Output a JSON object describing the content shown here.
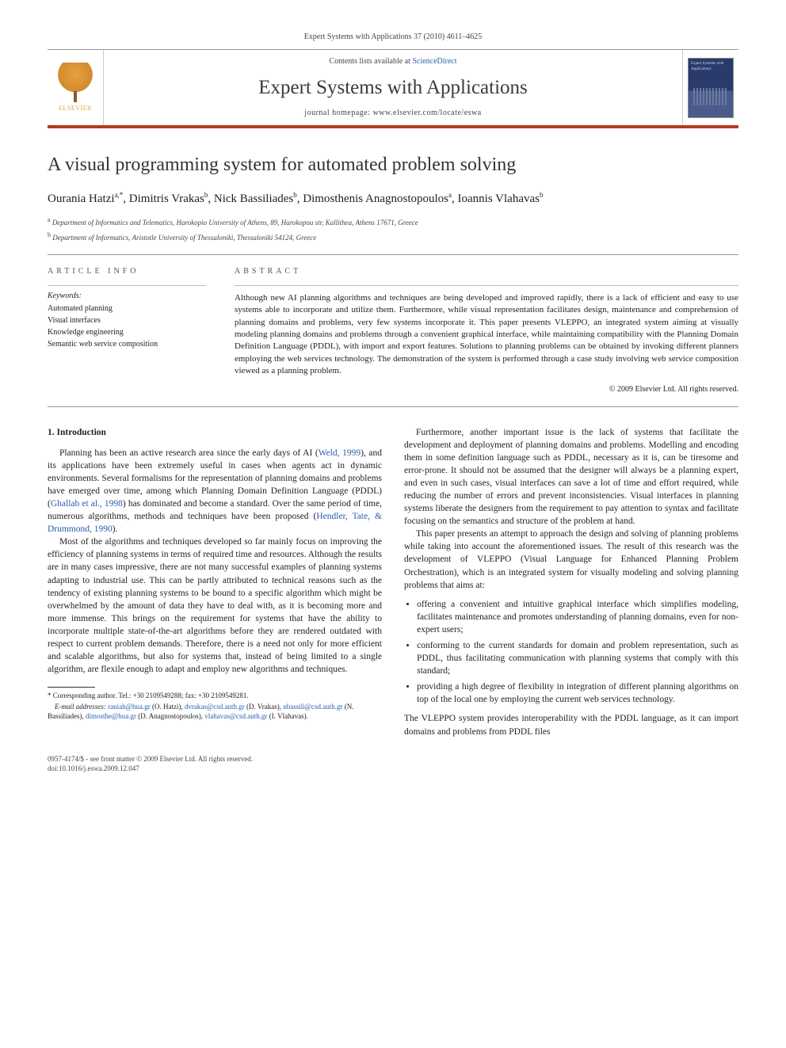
{
  "header": {
    "running": "Expert Systems with Applications 37 (2010) 4611–4625",
    "contents_prefix": "Contents lists available at ",
    "contents_link": "ScienceDirect",
    "journal": "Expert Systems with Applications",
    "homepage_prefix": "journal homepage: ",
    "homepage_url": "www.elsevier.com/locate/eswa",
    "elsevier": "ELSEVIER",
    "cover_text": "Expert Systems with Applications"
  },
  "title": "A visual programming system for automated problem solving",
  "authors_html": "Ourania Hatzi",
  "authors": [
    {
      "name": "Ourania Hatzi",
      "marks": "a,*"
    },
    {
      "name": "Dimitris Vrakas",
      "marks": "b"
    },
    {
      "name": "Nick Bassiliades",
      "marks": "b"
    },
    {
      "name": "Dimosthenis Anagnostopoulos",
      "marks": "a"
    },
    {
      "name": "Ioannis Vlahavas",
      "marks": "b"
    }
  ],
  "affiliations": [
    {
      "mark": "a",
      "text": "Department of Informatics and Telematics, Harokopio University of Athens, 89, Harokopou str, Kallithea, Athens 17671, Greece"
    },
    {
      "mark": "b",
      "text": "Department of Informatics, Aristotle University of Thessaloniki, Thessaloniki 54124, Greece"
    }
  ],
  "article_info": {
    "heading": "ARTICLE INFO",
    "keywords_label": "Keywords:",
    "keywords": [
      "Automated planning",
      "Visual interfaces",
      "Knowledge engineering",
      "Semantic web service composition"
    ]
  },
  "abstract": {
    "heading": "ABSTRACT",
    "text": "Although new AI planning algorithms and techniques are being developed and improved rapidly, there is a lack of efficient and easy to use systems able to incorporate and utilize them. Furthermore, while visual representation facilitates design, maintenance and comprehension of planning domains and problems, very few systems incorporate it. This paper presents VLEPPO, an integrated system aiming at visually modeling planning domains and problems through a convenient graphical interface, while maintaining compatibility with the Planning Domain Definition Language (PDDL), with import and export features. Solutions to planning problems can be obtained by invoking different planners employing the web services technology. The demonstration of the system is performed through a case study involving web service composition viewed as a planning problem.",
    "copyright": "© 2009 Elsevier Ltd. All rights reserved."
  },
  "section1": {
    "heading": "1. Introduction",
    "p1": "Planning has been an active research area since the early days of AI (",
    "ref1": "Weld, 1999",
    "p1b": "), and its applications have been extremely useful in cases when agents act in dynamic environments. Several formalisms for the representation of planning domains and problems have emerged over time, among which Planning Domain Definition Language (PDDL) (",
    "ref2": "Ghallab et al., 1998",
    "p1c": ") has dominated and become a standard. Over the same period of time, numerous algorithms, methods and techniques have been proposed (",
    "ref3": "Hendler, Tate, & Drummond, 1990",
    "p1d": ").",
    "p2": "Most of the algorithms and techniques developed so far mainly focus on improving the efficiency of planning systems in terms of required time and resources. Although the results are in many cases impressive, there are not many successful examples of planning systems adapting to industrial use. This can be partly attributed to technical reasons such as the tendency of existing planning systems to be bound to a specific algorithm which might be overwhelmed by the amount of data they have to deal with, as it is becoming more and more immense. This brings on the requirement for systems that have the ability to incorporate multiple state-of-the-art algorithms before they are rendered outdated with respect to current problem demands. Therefore, there is a need not only for more efficient and scalable algorithms, but also for systems that, instead of being limited to a single algorithm, are flexile enough to adapt and employ new algorithms and techniques.",
    "p3": "Furthermore, another important issue is the lack of systems that facilitate the development and deployment of planning domains and problems. Modelling and encoding them in some definition language such as PDDL, necessary as it is, can be tiresome and error-prone. It should not be assumed that the designer will always be a planning expert, and even in such cases, visual interfaces can save a lot of time and effort required, while reducing the number of errors and prevent inconsistencies. Visual interfaces in planning systems liberate the designers from the requirement to pay attention to syntax and facilitate focusing on the semantics and structure of the problem at hand.",
    "p4": "This paper presents an attempt to approach the design and solving of planning problems while taking into account the aforementioned issues. The result of this research was the development of VLEPPO (Visual Language for Enhanced Planning Problem Orchestration), which is an integrated system for visually modeling and solving planning problems that aims at:",
    "bullets": [
      "offering a convenient and intuitive graphical interface which simplifies modeling, facilitates maintenance and promotes understanding of planning domains, even for non-expert users;",
      "conforming to the current standards for domain and problem representation, such as PDDL, thus facilitating communication with planning systems that comply with this standard;",
      "providing a high degree of flexibility in integration of different planning algorithms on top of the local one by employing the current web services technology."
    ],
    "p5": "The VLEPPO system provides interoperability with the PDDL language, as it can import domains and problems from PDDL files"
  },
  "footnotes": {
    "corr": "* Corresponding author. Tel.: +30 2109549288; fax: +30 2109549281.",
    "emails_label": "E-mail addresses:",
    "emails": [
      {
        "addr": "raniah@hua.gr",
        "who": "(O. Hatzi)"
      },
      {
        "addr": "dvrakas@csd.auth.gr",
        "who": "(D. Vrakas)"
      },
      {
        "addr": "nbassili@csd.auth.gr",
        "who": "(N. Bassiliades)"
      },
      {
        "addr": "dimosthe@hua.gr",
        "who": "(D. Anagnostopoulos)"
      },
      {
        "addr": "vlahavas@csd.auth.gr",
        "who": "(I. Vlahavas)"
      }
    ]
  },
  "bottom": {
    "line1": "0957-4174/$ - see front matter © 2009 Elsevier Ltd. All rights reserved.",
    "line2": "doi:10.1016/j.eswa.2009.12.047"
  }
}
